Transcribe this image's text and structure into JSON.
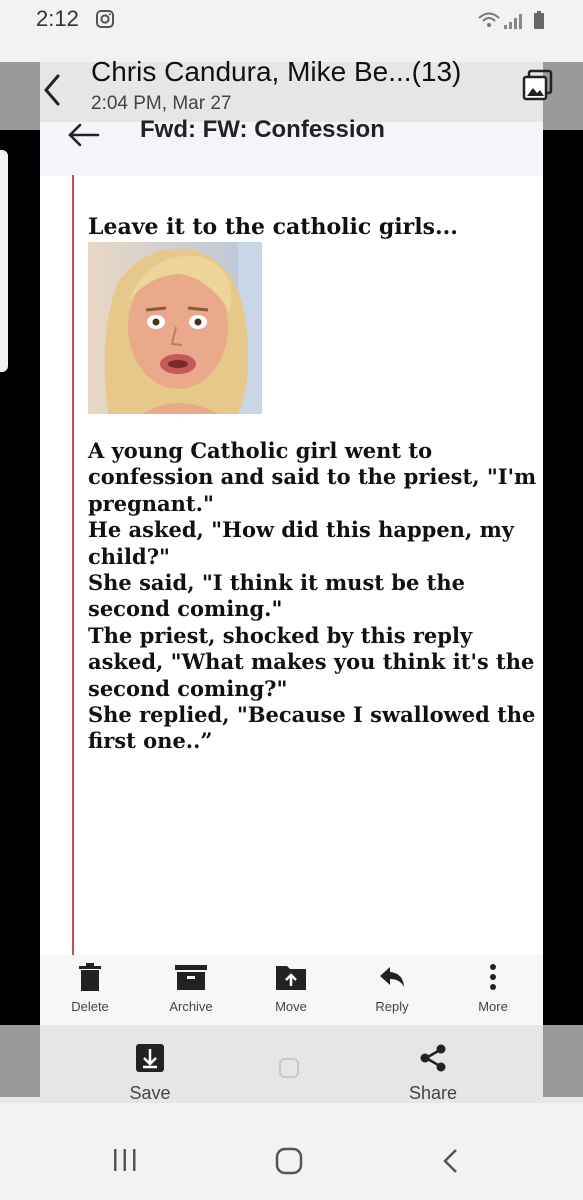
{
  "status_bar": {
    "time": "2:12"
  },
  "gallery_header": {
    "title": "Chris Candura, Mike Be...(13)",
    "subtitle": "2:04 PM, Mar 27"
  },
  "email": {
    "subject": "Fwd: FW: Confession",
    "lead": "Leave it to the catholic girls...",
    "body_lines": [
      "A young Catholic girl went to",
      "confession and said to the priest, \"I'm",
      "pregnant.\"",
      "He asked, \"How did this happen, my",
      "child?\"",
      "She said, \"I think it must be the",
      "second coming.\"",
      "The priest, shocked by this reply",
      "asked, \"What makes you think it's the",
      "second coming?\"",
      "She replied, \"Because I swallowed the",
      "first one..”"
    ]
  },
  "mail_toolbar": {
    "delete": "Delete",
    "archive": "Archive",
    "move": "Move",
    "reply": "Reply",
    "more": "More"
  },
  "gallery_toolbar": {
    "save": "Save",
    "share": "Share"
  },
  "colors": {
    "quote_bar": "#c0504d",
    "subject_bg": "#f4f5fb",
    "overlay_gray": "#9a9a9a"
  }
}
